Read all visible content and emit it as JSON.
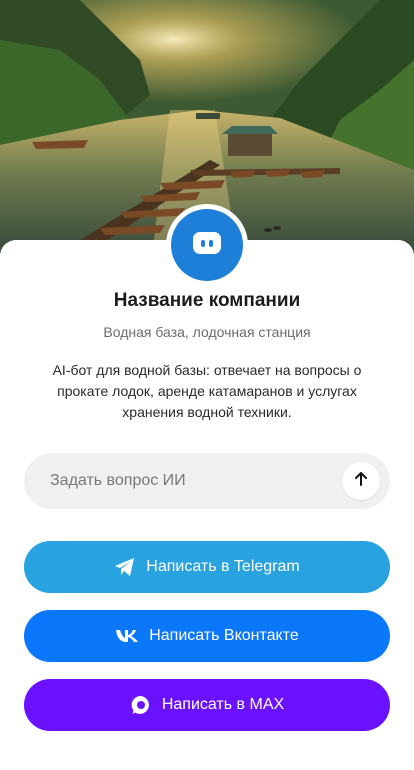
{
  "company": {
    "name": "Название компании",
    "category": "Водная база, лодочная станция",
    "description": "AI-бот для водной базы: отвечает на вопросы о прокате лодок, аренде катамаранов и услугах хранения водной техники."
  },
  "ask": {
    "placeholder": "Задать вопрос ИИ",
    "send_icon": "arrow-up-icon"
  },
  "buttons": {
    "telegram": {
      "label": "Написать в Telegram",
      "icon": "telegram-icon",
      "color": "#29a3e0"
    },
    "vk": {
      "label": "Написать Вконтакте",
      "icon": "vk-icon",
      "color": "#0b77fb"
    },
    "max": {
      "label": "Написать в MAX",
      "icon": "max-icon",
      "color": "#6a12ff"
    }
  },
  "colors": {
    "avatar": "#1e7fd8",
    "input_bg": "#f0f0f2"
  }
}
